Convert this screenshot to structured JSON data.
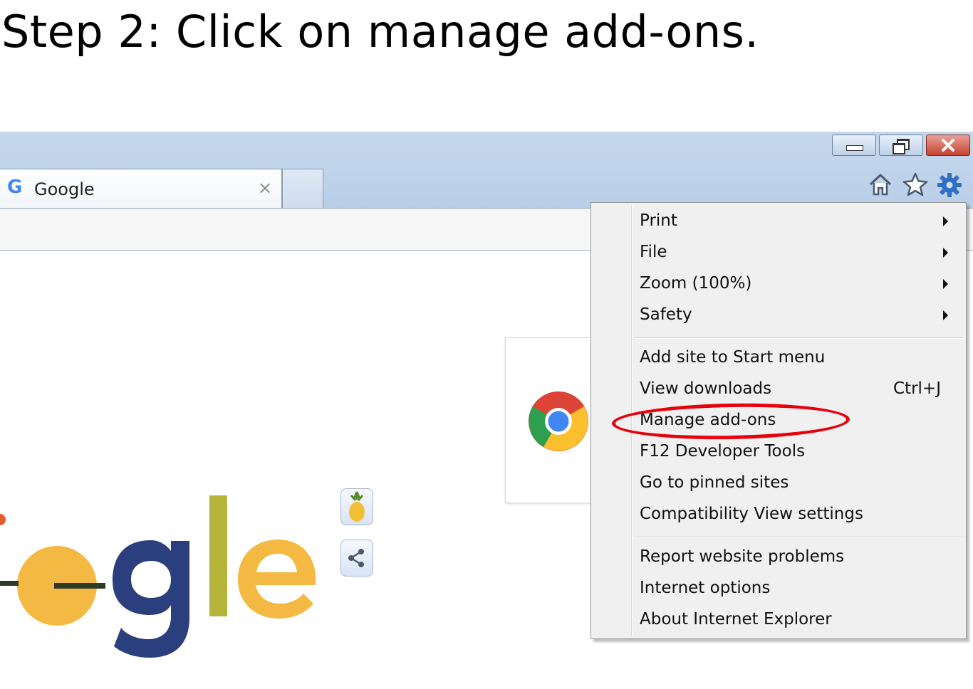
{
  "instruction": {
    "text": "Step 2: Click on manage add-ons."
  },
  "window": {
    "controls": {
      "minimize": "minimize-icon",
      "restore": "restore-icon",
      "close": "close-icon"
    }
  },
  "tab": {
    "favicon_letter": "G",
    "title": "Google",
    "close_glyph": "×"
  },
  "toolbar": {
    "home": "home-icon",
    "favorites": "star-icon",
    "tools": "gear-icon",
    "accent": "#2f6fc4"
  },
  "menu": {
    "items": [
      {
        "label": "Print",
        "submenu": true
      },
      {
        "label": "File",
        "submenu": true
      },
      {
        "label": "Zoom (100%)",
        "submenu": true
      },
      {
        "label": "Safety",
        "submenu": true
      },
      {
        "label": "Add site to Start menu"
      },
      {
        "label": "View downloads",
        "shortcut": "Ctrl+J"
      },
      {
        "label": "Manage add-ons",
        "highlighted": true
      },
      {
        "label": "F12 Developer Tools"
      },
      {
        "label": "Go to pinned sites"
      },
      {
        "label": "Compatibility View settings"
      },
      {
        "label": "Report website problems"
      },
      {
        "label": "Internet options"
      },
      {
        "label": "About Internet Explorer"
      }
    ],
    "highlight_color": "#e8000b"
  },
  "page": {
    "doodle_letters": "gle",
    "doodle_colors": {
      "g": "#2b3f7e",
      "l": "#b5b53c",
      "e": "#f4b942",
      "o": "#f4b942"
    },
    "side_buttons": [
      "pineapple-icon",
      "share-icon"
    ],
    "promo_icon": "chrome-logo-icon"
  }
}
